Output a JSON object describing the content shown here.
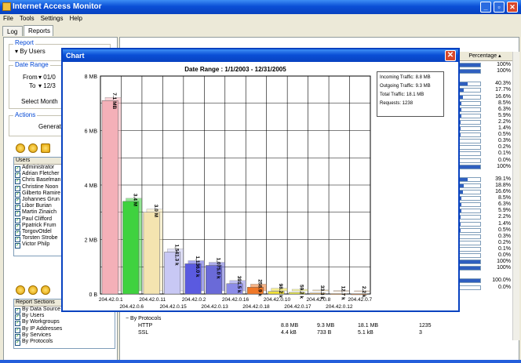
{
  "app": {
    "title": "Internet Access Monitor"
  },
  "menu": [
    "File",
    "Tools",
    "Settings",
    "Help"
  ],
  "tabs": [
    "Log",
    "Reports"
  ],
  "left": {
    "report_group": "Report",
    "report_select": "By Users",
    "date_group": "Date Range",
    "from_label": "From",
    "from_value": "01/0",
    "to_label": "To",
    "to_value": "12/3",
    "select_month": "Select Month",
    "actions_group": "Actions",
    "generate": "Generate",
    "users_header": "Users",
    "users": [
      "Administrator",
      "Adrian Fletcher",
      "Chris Baselman",
      "Christine Noon",
      "Gilberto Ramire",
      "Johannes Grun",
      "Libor Burian",
      "Martin Zinaich",
      "Paul Clifford",
      "Ppatrick Frum",
      "TorgovOtdel",
      "Torsten Strobe",
      "Victor Philp"
    ],
    "sections_header": "Report Sections",
    "sections": [
      "By Data Source",
      "By Users",
      "By Workgroups",
      "By IP Addresses",
      "By Services",
      "By Protocols"
    ]
  },
  "percentage_header": "Percentage",
  "percentages": [
    {
      "v": "100%",
      "f": 1.0
    },
    {
      "v": "100%",
      "f": 1.0
    },
    {
      "v": "",
      "f": 0
    },
    {
      "v": "40.3%",
      "f": 0.403
    },
    {
      "v": "17.7%",
      "f": 0.177
    },
    {
      "v": "16.6%",
      "f": 0.166
    },
    {
      "v": "8.5%",
      "f": 0.085
    },
    {
      "v": "6.3%",
      "f": 0.063
    },
    {
      "v": "5.9%",
      "f": 0.059
    },
    {
      "v": "2.2%",
      "f": 0.022
    },
    {
      "v": "1.4%",
      "f": 0.014
    },
    {
      "v": "0.5%",
      "f": 0.005
    },
    {
      "v": "0.3%",
      "f": 0.003
    },
    {
      "v": "0.2%",
      "f": 0.002
    },
    {
      "v": "0.1%",
      "f": 0.001
    },
    {
      "v": "0.0%",
      "f": 0
    },
    {
      "v": "100%",
      "f": 1.0
    },
    {
      "v": "",
      "f": 0
    },
    {
      "v": "39.1%",
      "f": 0.391
    },
    {
      "v": "18.8%",
      "f": 0.188
    },
    {
      "v": "16.6%",
      "f": 0.166
    },
    {
      "v": "8.5%",
      "f": 0.085
    },
    {
      "v": "6.3%",
      "f": 0.063
    },
    {
      "v": "5.9%",
      "f": 0.059
    },
    {
      "v": "2.2%",
      "f": 0.022
    },
    {
      "v": "1.4%",
      "f": 0.014
    },
    {
      "v": "0.5%",
      "f": 0.005
    },
    {
      "v": "0.3%",
      "f": 0.003
    },
    {
      "v": "0.2%",
      "f": 0.002
    },
    {
      "v": "0.1%",
      "f": 0.001
    },
    {
      "v": "0.0%",
      "f": 0
    },
    {
      "v": "100%",
      "f": 1.0
    },
    {
      "v": "100%",
      "f": 1.0
    },
    {
      "v": "",
      "f": 0
    },
    {
      "v": "100.0%",
      "f": 1.0
    },
    {
      "v": "0.0%",
      "f": 0
    }
  ],
  "bottom": {
    "by_protocols": "By Protocols",
    "rows": [
      {
        "name": "HTTP",
        "c1": "8.8 MB",
        "c2": "9.3 MB",
        "c3": "18.1 MB",
        "c4": "1235"
      },
      {
        "name": "SSL",
        "c1": "4.4 kB",
        "c2": "733 B",
        "c3": "5.1 kB",
        "c4": "3"
      }
    ]
  },
  "chart_window": {
    "title": "Chart",
    "legend": [
      "Incoming Traffic: 8.8 MB",
      "Outgoing Traffic: 9.3 MB",
      "Total Traffic: 18.1 MB",
      "Requests: 1238"
    ]
  },
  "chart_data": {
    "type": "bar",
    "title": "Date Range : 1/1/2003 - 12/31/2005",
    "ylim": [
      0,
      8
    ],
    "yticks": [
      "0 B",
      "2 MB",
      "4 MB",
      "6 MB",
      "8 MB"
    ],
    "categories": [
      "204.42.0.1",
      "204.42.0.6",
      "204.42.0.11",
      "204.42.0.15",
      "204.42.0.2",
      "204.42.0.13",
      "204.42.0.16",
      "204.42.0.18",
      "204.42.0.10",
      "204.42.0.17",
      "204.42.0.8",
      "204.42.0.12",
      "204.42.0.7"
    ],
    "values": [
      7.1,
      3.4,
      3.0,
      1.54,
      1.11,
      1.05,
      0.38,
      0.25,
      0.096,
      0.058,
      0.033,
      0.012,
      0.002
    ],
    "labels": [
      "7.1 MB",
      "3.4 M",
      "3.0 M",
      "1,541.3 k",
      "1,136.0 k",
      "1,075.0 k",
      "391.5 k",
      "258.9 k",
      "98.2 k",
      "59.2 k",
      "33.3 k",
      "12.7 k",
      "2.2 k"
    ],
    "colors": [
      "#f4b0b8",
      "#3fd23f",
      "#f4e4b0",
      "#c8c8f4",
      "#5a5ae0",
      "#6a6ad8",
      "#8c8ce8",
      "#f07828",
      "#f0e038",
      "#f0f050",
      "#f4c060",
      "#f0a050",
      "#e89050"
    ]
  }
}
